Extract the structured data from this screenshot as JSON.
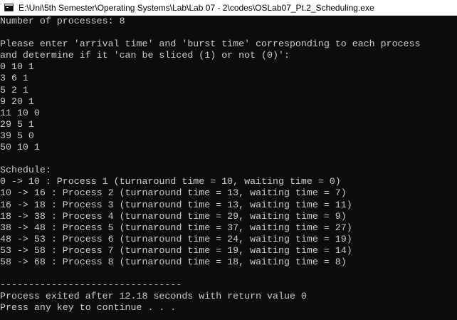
{
  "window": {
    "title": "E:\\Uni\\5th Semester\\Operating Systems\\Lab\\Lab 07 - 2\\codes\\OSLab07_Pt.2_Scheduling.exe",
    "icon": "console-app-icon",
    "text_color": "#cccccc",
    "background_color": "#0c0c0c"
  },
  "console": {
    "lines": [
      "Number of processes: 8",
      "",
      "Please enter 'arrival time' and 'burst time' corresponding to each process",
      "and determine if it 'can be sliced (1) or not (0)':",
      "0 10 1",
      "3 6 1",
      "5 2 1",
      "9 20 1",
      "11 10 0",
      "29 5 1",
      "39 5 0",
      "50 10 1",
      "",
      "Schedule:",
      "0 -> 10 : Process 1 (turnaround time = 10, waiting time = 0)",
      "10 -> 16 : Process 2 (turnaround time = 13, waiting time = 7)",
      "16 -> 18 : Process 3 (turnaround time = 13, waiting time = 11)",
      "18 -> 38 : Process 4 (turnaround time = 29, waiting time = 9)",
      "38 -> 48 : Process 5 (turnaround time = 37, waiting time = 27)",
      "48 -> 53 : Process 6 (turnaround time = 24, waiting time = 19)",
      "53 -> 58 : Process 7 (turnaround time = 19, waiting time = 14)",
      "58 -> 68 : Process 8 (turnaround time = 18, waiting time = 8)",
      "",
      "--------------------------------",
      "Process exited after 12.18 seconds with return value 0",
      "Press any key to continue . . ."
    ]
  }
}
